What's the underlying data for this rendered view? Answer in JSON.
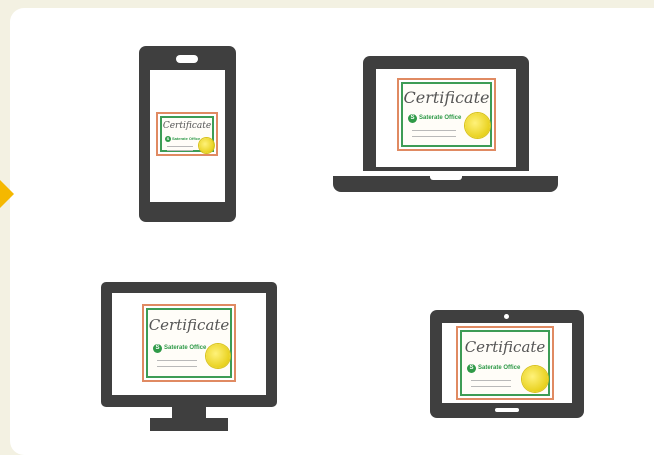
{
  "certificate": {
    "title": "Certificate",
    "logo_mark": "S",
    "logo_text": "Saterate Office"
  },
  "colors": {
    "background": "#f3f1e2",
    "device": "#3f3f3f",
    "accent_arrow": "#f5b800",
    "cert_border_outer": "#e08a62",
    "cert_border_inner": "#3d9c55",
    "seal": "#e8d11e",
    "logo": "#2f9a48"
  },
  "devices": [
    "smartphone",
    "laptop",
    "desktop-monitor",
    "tablet"
  ]
}
